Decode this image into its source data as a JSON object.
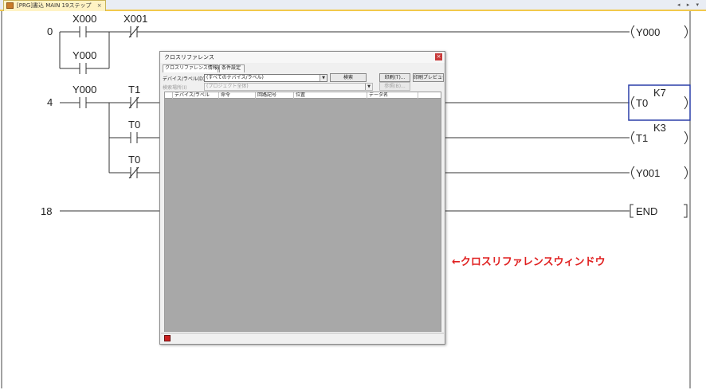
{
  "document_tab": {
    "label": "[PRG]書込 MAIN 19ステップ",
    "close": "×"
  },
  "nav_arrows": "◂ ▸ ▾",
  "ladder": {
    "step_numbers": [
      "0",
      "4",
      "18"
    ],
    "contacts": [
      "X000",
      "X001",
      "Y000",
      "Y000",
      "T1",
      "T0",
      "T0"
    ],
    "coils": [
      "Y000",
      "T0",
      "T1",
      "Y001",
      "END"
    ],
    "constants": [
      "K7",
      "K3"
    ]
  },
  "note": "←クロスリファレンスウィンドウ",
  "xref": {
    "title": "クロスリファレンス",
    "close": "×",
    "tabs": [
      "クロスリファレンス情報表示",
      "条件設定"
    ],
    "device_label": "デバイス/ラベル(D)",
    "device_value": "(すべてのデバイス/ラベル)",
    "search_button": "検索",
    "print_button": "印刷(T)...",
    "print_preview_button": "印刷プレビュー",
    "search_location_label": "検索場所(I)",
    "search_location_value": "(プロジェクト全体)",
    "browse_button": "参照(B)...",
    "columns": [
      "デバイス/ラベル",
      "命令",
      "回路記号",
      "位置",
      "データ名"
    ]
  },
  "colors": {
    "note": "#e02020",
    "selection": "#2b3fa8",
    "list_bg": "#a8a8a8"
  }
}
